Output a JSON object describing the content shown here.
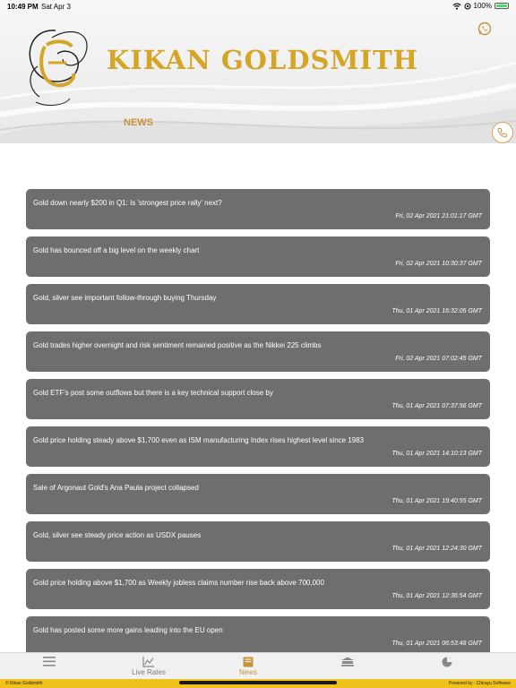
{
  "status_bar": {
    "time": "10:49 PM",
    "date": "Sat Apr 3",
    "battery": "100%"
  },
  "header": {
    "brand": "KIKAN GOLDSMITH",
    "section_title": "NEWS"
  },
  "news": [
    {
      "headline": "Gold down nearly $200 in Q1: Is 'strongest price rally' next?",
      "timestamp": "Fri, 02 Apr 2021 21:01:17 GMT"
    },
    {
      "headline": "Gold has bounced off a big level on the weekly chart",
      "timestamp": "Fri, 02 Apr 2021 10:30:37 GMT"
    },
    {
      "headline": "Gold, silver see important follow-through buying Thursday",
      "timestamp": "Thu, 01 Apr 2021 16:32:05 GMT"
    },
    {
      "headline": "Gold trades higher overnight and risk sentiment remained positive as the Nikkei 225 climbs",
      "timestamp": "Fri, 02 Apr 2021 07:02:45 GMT"
    },
    {
      "headline": "Gold ETF's post some outflows but there is a key technical support close by",
      "timestamp": "Thu, 01 Apr 2021 07:37:56 GMT"
    },
    {
      "headline": "Gold price holding steady above $1,700 even as ISM manufacturing Index rises highest level since 1983",
      "timestamp": "Thu, 01 Apr 2021 14:10:13 GMT"
    },
    {
      "headline": "Sale of Argonaut Gold's Ana Paula project collapsed",
      "timestamp": "Thu, 01 Apr 2021 19:40:55 GMT"
    },
    {
      "headline": "Gold, silver see steady price action as USDX pauses",
      "timestamp": "Thu, 01 Apr 2021 12:24:30 GMT"
    },
    {
      "headline": "Gold price holding above $1,700 as Weekly jobless claims number rise back above 700,000",
      "timestamp": "Thu, 01 Apr 2021 12:36:54 GMT"
    },
    {
      "headline": "Gold has posted some more gains leading into the EU open",
      "timestamp": "Thu, 01 Apr 2021 06:53:48 GMT"
    }
  ],
  "tabs": [
    {
      "label": "",
      "icon": "menu-icon"
    },
    {
      "label": "Live Rates",
      "icon": "chart-icon"
    },
    {
      "label": "News",
      "icon": "book-icon"
    },
    {
      "label": "",
      "icon": "bank-icon"
    },
    {
      "label": "",
      "icon": "pie-chart-icon"
    }
  ],
  "footer": {
    "left": "© Kikan Goldsmith",
    "right": "Powered by : Chirayu Software"
  },
  "colors": {
    "accent": "#c8913a",
    "brand_gold": "#d4a527",
    "card": "#6e6e6e",
    "footer": "#f0c11a"
  }
}
